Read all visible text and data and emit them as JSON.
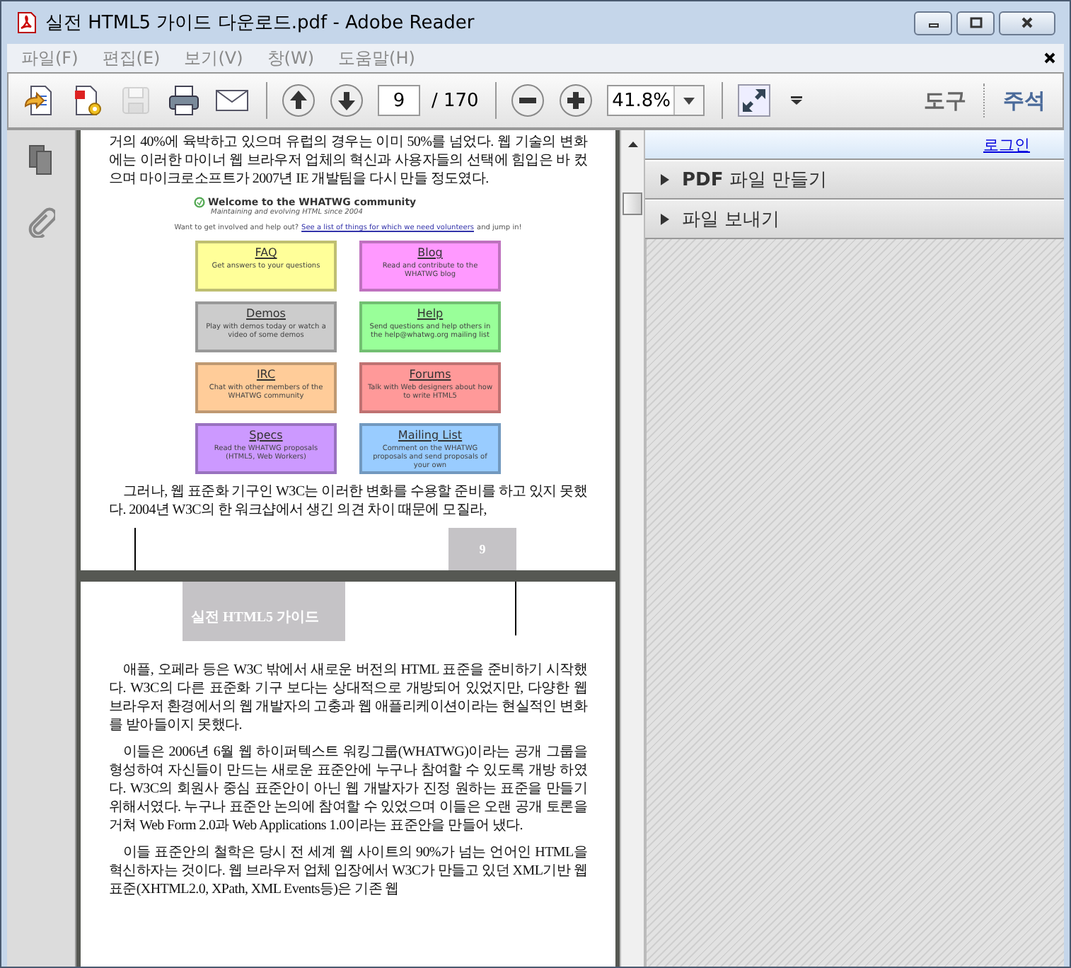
{
  "window": {
    "title": "실전 HTML5 가이드 다운로드.pdf - Adobe Reader"
  },
  "menu": [
    {
      "label": "파일(F)"
    },
    {
      "label": "편집(E)"
    },
    {
      "label": "보기(V)"
    },
    {
      "label": "창(W)"
    },
    {
      "label": "도움말(H)"
    }
  ],
  "toolbar": {
    "file_tools": [
      {
        "kind": "create",
        "disabled": false
      },
      {
        "kind": "review",
        "disabled": false
      },
      {
        "kind": "save",
        "disabled": true
      },
      {
        "kind": "print",
        "disabled": false
      },
      {
        "kind": "mail",
        "disabled": false
      }
    ],
    "page_field": "9",
    "page_total": "/ 170",
    "zoom": "41.8%",
    "panes": [
      {
        "label": "도구"
      },
      {
        "label": "주석"
      }
    ]
  },
  "document": {
    "page_1": {
      "paragraphs_before": [
        "거의 40%에 육박하고 있으며 유럽의 경우는 이미 50%를 넘었다. 웹 기술의 변화에는 이러한 마이너 웹 브라우저 업체의 혁신과 사용자들의 선택에 힘입은 바 컸으며 마이크로소프트가 2007년 IE 개발팀을 다시 만들 정도였다."
      ],
      "figure": {
        "title": "Welcome to the WHATWG community",
        "subtitle": "Maintaining and evolving HTML since 2004",
        "intro_before": "Want to get involved and help out?",
        "intro_link": "See a list of things for which we need volunteers",
        "intro_after": "and jump in!",
        "tiles": [
          {
            "title": "FAQ",
            "description": "Get answers to your questions",
            "color": "#ffff99"
          },
          {
            "title": "Blog",
            "description": "Read and contribute to the WHATWG blog",
            "color": "#ff99ff"
          },
          {
            "title": "Demos",
            "description": "Play with demos today or watch a video of some demos",
            "color": "#cccccc"
          },
          {
            "title": "Help",
            "description": "Send questions and help others in the help@whatwg.org mailing list",
            "color": "#99ff99"
          },
          {
            "title": "IRC",
            "description": "Chat with other members of the WHATWG community",
            "color": "#ffcc99"
          },
          {
            "title": "Forums",
            "description": "Talk with Web designers about how to write HTML5",
            "color": "#ff9999"
          },
          {
            "title": "Specs",
            "description": "Read the WHATWG proposals (HTML5, Web Workers)",
            "color": "#cc99ff"
          },
          {
            "title": "Mailing List",
            "description": "Comment on the WHATWG proposals and send proposals of your own",
            "color": "#99ccff"
          }
        ]
      },
      "paragraphs_after": [
        "그러나, 웹 표준화 기구인 W3C는 이러한 변화를 수용할 준비를 하고 있지 못했다. 2004년 W3C의 한 워크샵에서 생긴 의견 차이 때문에 모질라,"
      ],
      "page_number": "9"
    },
    "page_2": {
      "header": "실전 HTML5 가이드",
      "paragraphs": [
        "애플, 오페라 등은 W3C 밖에서 새로운 버전의 HTML 표준을 준비하기 시작했다. W3C의 다른 표준화 기구 보다는 상대적으로 개방되어 있었지만, 다양한 웹 브라우저 환경에서의 웹 개발자의 고충과 웹 애플리케이션이라는 현실적인 변화를 받아들이지 못했다.",
        "이들은 2006년 6월 웹 하이퍼텍스트 워킹그룹(WHATWG)이라는 공개 그룹을 형성하여 자신들이 만드는 새로운 표준안에 누구나 참여할 수 있도록 개방 하였다. W3C의 회원사 중심 표준안이 아닌 웹 개발자가 진정 원하는 표준을 만들기 위해서였다. 누구나 표준안 논의에 참여할 수 있었으며 이들은 오랜 공개 토론을 거쳐 Web Form 2.0과 Web Applications 1.0이라는 표준안을 만들어 냈다.",
        "이들 표준안의 철학은 당시 전 세계 웹 사이트의 90%가 넘는 언어인 HTML을 혁신하자는 것이다. 웹 브라우저 업체 입장에서 W3C가 만들고 있던 XML기반 웹 표준(XHTML2.0, XPath, XML Events등)은 기존 웹"
      ]
    }
  },
  "right_panel": {
    "login": "로그인",
    "sections": [
      {
        "label": "**PDF** 파일 만들기",
        "expanded": false
      },
      {
        "label": "파일 보내기",
        "expanded": false
      }
    ]
  }
}
